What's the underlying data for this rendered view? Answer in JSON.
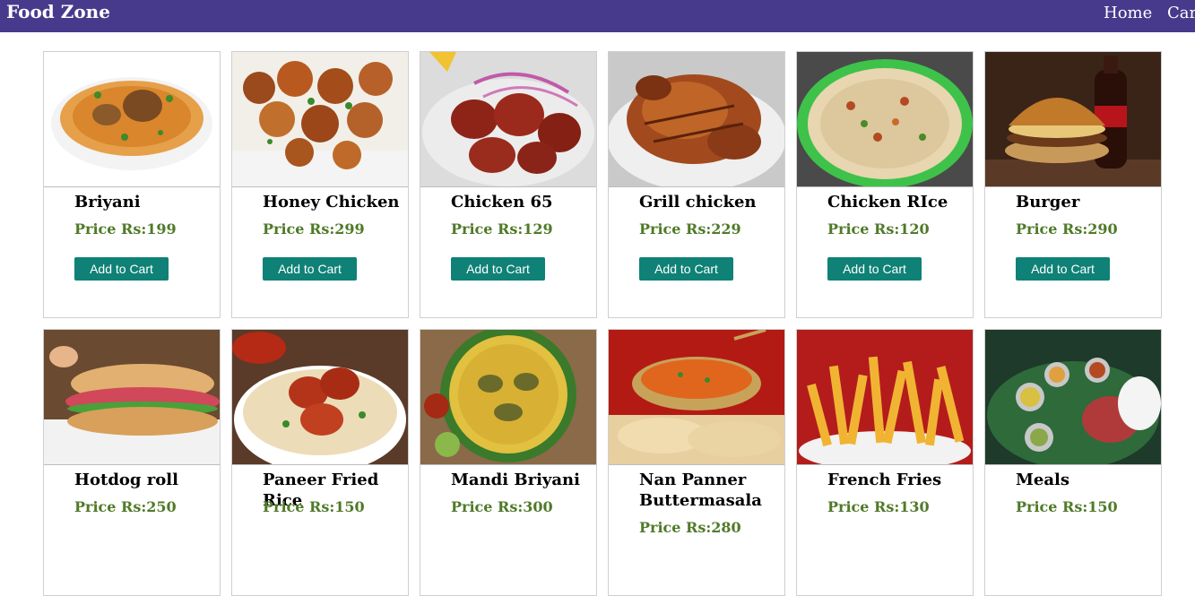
{
  "header": {
    "brand": "Food Zone",
    "nav": {
      "home": "Home",
      "cart": "Cart"
    }
  },
  "add_to_cart_label": "Add to Cart",
  "products": [
    {
      "name": "Briyani",
      "price": "Price Rs:199",
      "image_icon": "biryani-plate-icon"
    },
    {
      "name": "Honey Chicken",
      "price": "Price Rs:299",
      "image_icon": "honey-chicken-icon"
    },
    {
      "name": "Chicken 65",
      "price": "Price Rs:129",
      "image_icon": "chicken-65-icon"
    },
    {
      "name": "Grill chicken",
      "price": "Price Rs:229",
      "image_icon": "grill-chicken-icon"
    },
    {
      "name": "Chicken RIce",
      "price": "Price Rs:120",
      "image_icon": "chicken-rice-icon"
    },
    {
      "name": "Burger",
      "price": "Price Rs:290",
      "image_icon": "burger-icon"
    },
    {
      "name": "Hotdog roll",
      "price": "Price Rs:250",
      "image_icon": "hotdog-roll-icon"
    },
    {
      "name": "Paneer Fried Rice",
      "price": "Price Rs:150",
      "image_icon": "paneer-fried-rice-icon"
    },
    {
      "name": "Mandi Briyani",
      "price": "Price Rs:300",
      "image_icon": "mandi-biryani-icon"
    },
    {
      "name": "Nan Panner Buttermasala",
      "price": "Price Rs:280",
      "image_icon": "naan-paneer-icon"
    },
    {
      "name": "French Fries",
      "price": "Price Rs:130",
      "image_icon": "french-fries-icon"
    },
    {
      "name": "Meals",
      "price": "Price Rs:150",
      "image_icon": "meals-thali-icon"
    }
  ],
  "colors": {
    "navbar": "#473a8c",
    "price": "#4f7a28",
    "button": "#0f8176"
  }
}
